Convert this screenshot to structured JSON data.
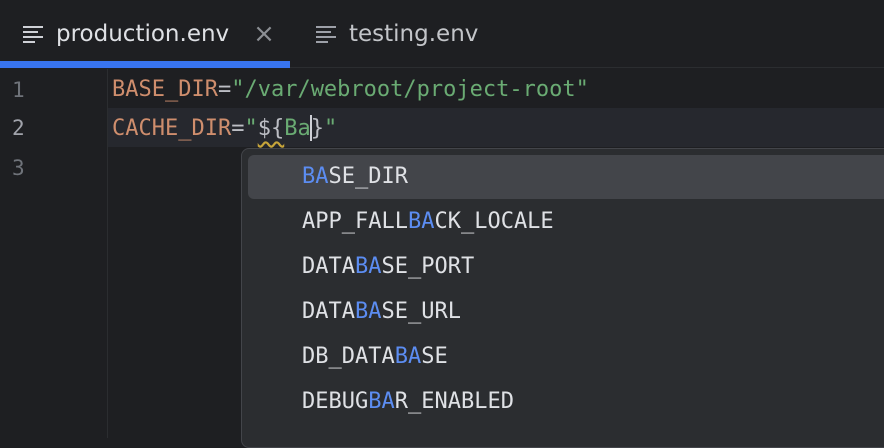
{
  "tabs": [
    {
      "label": "production.env",
      "icon": "text-file-icon",
      "active": true,
      "close": "×"
    },
    {
      "label": "testing.env",
      "icon": "text-file-icon",
      "active": false
    }
  ],
  "editor": {
    "line_numbers": [
      "1",
      "2",
      "3"
    ],
    "lines": [
      {
        "key": "BASE_DIR",
        "eq": "=",
        "value": "\"/var/webroot/project-root\""
      },
      {
        "key": "CACHE_DIR",
        "eq": "=",
        "q1": "\"",
        "tpl": "${",
        "typed": "Ba",
        "brace": "}",
        "q2": "\""
      }
    ]
  },
  "completion": {
    "items": [
      {
        "pre": "",
        "match": "BA",
        "post": "SE_DIR",
        "selected": true
      },
      {
        "pre": "APP_FALL",
        "match": "BA",
        "post": "CK_LOCALE"
      },
      {
        "pre": "DATA",
        "match": "BA",
        "post": "SE_PORT"
      },
      {
        "pre": "DATA",
        "match": "BA",
        "post": "SE_URL"
      },
      {
        "pre": "DB_DATA",
        "match": "BA",
        "post": "SE"
      },
      {
        "pre": "DEBUG",
        "match": "BA",
        "post": "R_ENABLED"
      }
    ]
  },
  "colors": {
    "accent": "#3874f0",
    "match_highlight": "#5c8df2",
    "key": "#cf8e6d",
    "string": "#6aab73"
  }
}
